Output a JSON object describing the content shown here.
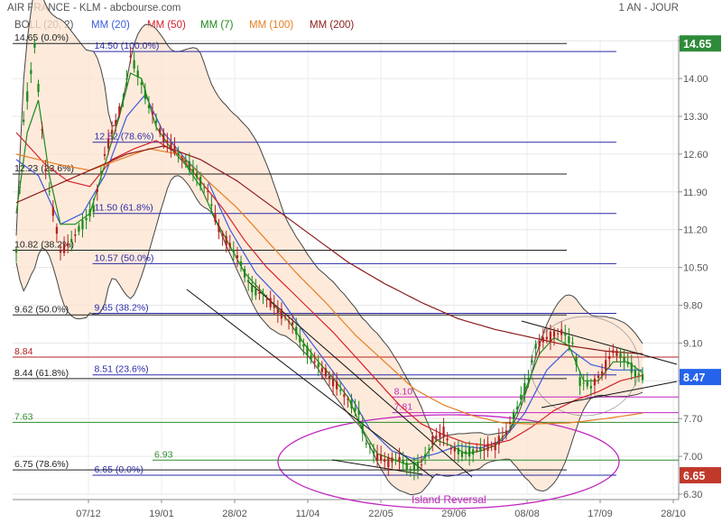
{
  "header": {
    "title": "AIR FRANCE - KLM - abcbourse.com",
    "period": "1 AN - JOUR",
    "legend": [
      {
        "label": "BOLL (20, 2)",
        "color": "#555555"
      },
      {
        "label": "MM (20)",
        "color": "#3b5bdb"
      },
      {
        "label": "MM (50)",
        "color": "#d6202a"
      },
      {
        "label": "MM (7)",
        "color": "#1a8a1a"
      },
      {
        "label": "MM (100)",
        "color": "#e67e22"
      },
      {
        "label": "MM (200)",
        "color": "#8b1a1a"
      }
    ]
  },
  "chart_data": {
    "type": "candlestick",
    "ylim": [
      6.3,
      14.72
    ],
    "y_ticks": [
      "14.70",
      "14.00",
      "13.30",
      "12.60",
      "11.90",
      "11.20",
      "10.50",
      "9.80",
      "9.10",
      "8.40",
      "7.70",
      "7.00",
      "6.30"
    ],
    "x_ticks": [
      "07/12",
      "19/01",
      "28/02",
      "11/04",
      "22/05",
      "29/06",
      "08/08",
      "17/09",
      "28/10"
    ],
    "price_badges": [
      {
        "label": "14.65",
        "value": 14.65,
        "color": "#2e8b3a"
      },
      {
        "label": "8.47",
        "value": 8.47,
        "color": "#2563eb"
      },
      {
        "label": "6.65",
        "value": 6.65,
        "color": "#c0392b"
      }
    ],
    "levels": [
      {
        "label": "14.65  (0.0%)",
        "value": 14.65,
        "color": "#222222",
        "x0": 0,
        "x1": 100
      },
      {
        "label": "14.50  (100.0%)",
        "value": 14.5,
        "color": "#2a2aa8",
        "x0": 12,
        "x1": 100
      },
      {
        "label": "12.82  (78.6%)",
        "value": 12.82,
        "color": "#2a2aa8",
        "x0": 12,
        "x1": 100
      },
      {
        "label": "12.23  (23.6%)",
        "value": 12.23,
        "color": "#222222",
        "x0": 0,
        "x1": 100
      },
      {
        "label": "11.50  (61.8%)",
        "value": 11.5,
        "color": "#2a2aa8",
        "x0": 12,
        "x1": 100
      },
      {
        "label": "10.82  (38.2%)",
        "value": 10.82,
        "color": "#222222",
        "x0": 0,
        "x1": 100
      },
      {
        "label": "10.57  (50.0%)",
        "value": 10.57,
        "color": "#2a2aa8",
        "x0": 12,
        "x1": 100
      },
      {
        "label": "9.62  (50.0%)",
        "value": 9.62,
        "color": "#222222",
        "x0": 0,
        "x1": 100
      },
      {
        "label": "9.65  (38.2%)",
        "value": 9.65,
        "color": "#2a2aa8",
        "x0": 12,
        "x1": 100
      },
      {
        "label": "8.84",
        "value": 8.84,
        "color": "#b22222",
        "x0": 0,
        "x1": 100
      },
      {
        "label": "8.44  (61.8%)",
        "value": 8.44,
        "color": "#222222",
        "x0": 0,
        "x1": 100
      },
      {
        "label": "8.51  (23.6%)",
        "value": 8.51,
        "color": "#2a2aa8",
        "x0": 12,
        "x1": 100
      },
      {
        "label": "8.10",
        "value": 8.1,
        "color": "#c026c0",
        "x0": 57,
        "x1": 100
      },
      {
        "label": "7.81",
        "value": 7.81,
        "color": "#c026c0",
        "x0": 57,
        "x1": 100
      },
      {
        "label": "7.63",
        "value": 7.63,
        "color": "#2e8b2e",
        "x0": 0,
        "x1": 100
      },
      {
        "label": "6.93",
        "value": 6.93,
        "color": "#2e8b2e",
        "x0": 21,
        "x1": 100
      },
      {
        "label": "6.75  (78.6%)",
        "value": 6.75,
        "color": "#222222",
        "x0": 0,
        "x1": 100
      },
      {
        "label": "6.65  (0.0%)",
        "value": 6.65,
        "color": "#2a2aa8",
        "x0": 12,
        "x1": 100
      }
    ],
    "annotations": [
      {
        "label": "Island Reversal",
        "color": "#c026c0"
      }
    ],
    "price_anchors": [
      [
        0,
        10.8
      ],
      [
        2,
        13.2
      ],
      [
        5,
        14.6
      ],
      [
        8,
        12.3
      ],
      [
        12,
        10.8
      ],
      [
        14,
        10.9
      ],
      [
        18,
        11.3
      ],
      [
        21,
        11.6
      ],
      [
        24,
        12.6
      ],
      [
        26,
        13.0
      ],
      [
        29,
        13.6
      ],
      [
        31,
        14.4
      ],
      [
        33,
        14.1
      ],
      [
        36,
        13.5
      ],
      [
        40,
        12.9
      ],
      [
        44,
        12.6
      ],
      [
        48,
        12.3
      ],
      [
        52,
        11.9
      ],
      [
        55,
        11.2
      ],
      [
        58,
        10.9
      ],
      [
        60,
        10.7
      ],
      [
        64,
        10.1
      ],
      [
        67,
        10.0
      ],
      [
        71,
        9.7
      ],
      [
        75,
        9.45
      ],
      [
        78,
        9.05
      ],
      [
        81,
        8.75
      ],
      [
        84,
        8.55
      ],
      [
        87,
        8.3
      ],
      [
        90,
        8.05
      ],
      [
        93,
        7.8
      ],
      [
        95,
        7.25
      ],
      [
        98,
        7.0
      ],
      [
        101,
        6.9
      ],
      [
        104,
        6.95
      ],
      [
        107,
        6.75
      ],
      [
        110,
        6.85
      ],
      [
        113,
        7.3
      ],
      [
        116,
        7.45
      ],
      [
        118,
        7.15
      ],
      [
        121,
        7.05
      ],
      [
        124,
        7.1
      ],
      [
        127,
        7.15
      ],
      [
        130,
        7.2
      ],
      [
        133,
        7.45
      ],
      [
        136,
        7.9
      ],
      [
        139,
        8.45
      ],
      [
        141,
        9.05
      ],
      [
        144,
        9.2
      ],
      [
        148,
        9.3
      ],
      [
        151,
        9.1
      ],
      [
        153,
        8.4
      ],
      [
        156,
        8.3
      ],
      [
        159,
        8.55
      ],
      [
        162,
        8.95
      ],
      [
        165,
        8.8
      ],
      [
        168,
        8.55
      ],
      [
        170,
        8.47
      ]
    ],
    "ma_anchors": {
      "MM (20)": [
        [
          0,
          12.5
        ],
        [
          6,
          12.2
        ],
        [
          12,
          11.3
        ],
        [
          18,
          11.5
        ],
        [
          24,
          12.2
        ],
        [
          30,
          13.3
        ],
        [
          35,
          13.7
        ],
        [
          40,
          13.0
        ],
        [
          46,
          12.5
        ],
        [
          52,
          12.1
        ],
        [
          58,
          11.2
        ],
        [
          65,
          10.4
        ],
        [
          72,
          9.9
        ],
        [
          78,
          9.3
        ],
        [
          84,
          8.75
        ],
        [
          90,
          8.2
        ],
        [
          96,
          7.5
        ],
        [
          102,
          7.1
        ],
        [
          108,
          6.95
        ],
        [
          114,
          7.05
        ],
        [
          120,
          7.2
        ],
        [
          126,
          7.15
        ],
        [
          132,
          7.3
        ],
        [
          138,
          7.8
        ],
        [
          144,
          8.6
        ],
        [
          150,
          9.0
        ],
        [
          156,
          8.7
        ],
        [
          162,
          8.6
        ],
        [
          170,
          8.6
        ]
      ],
      "MM (50)": [
        [
          0,
          13.0
        ],
        [
          8,
          12.4
        ],
        [
          14,
          12.1
        ],
        [
          20,
          12.0
        ],
        [
          26,
          12.5
        ],
        [
          32,
          12.7
        ],
        [
          38,
          12.85
        ],
        [
          44,
          12.6
        ],
        [
          50,
          12.1
        ],
        [
          56,
          11.6
        ],
        [
          62,
          11.0
        ],
        [
          68,
          10.5
        ],
        [
          74,
          10.1
        ],
        [
          80,
          9.7
        ],
        [
          86,
          9.3
        ],
        [
          92,
          8.85
        ],
        [
          98,
          8.4
        ],
        [
          104,
          7.95
        ],
        [
          110,
          7.6
        ],
        [
          116,
          7.4
        ],
        [
          122,
          7.25
        ],
        [
          128,
          7.2
        ],
        [
          134,
          7.3
        ],
        [
          140,
          7.55
        ],
        [
          146,
          7.85
        ],
        [
          152,
          8.05
        ],
        [
          158,
          8.2
        ],
        [
          164,
          8.4
        ],
        [
          170,
          8.5
        ]
      ],
      "MM (7)": [
        [
          0,
          11.5
        ],
        [
          3,
          13.0
        ],
        [
          6,
          13.6
        ],
        [
          9,
          12.2
        ],
        [
          12,
          11.3
        ],
        [
          16,
          11.3
        ],
        [
          20,
          11.5
        ],
        [
          24,
          12.4
        ],
        [
          28,
          13.3
        ],
        [
          31,
          14.1
        ],
        [
          34,
          14.0
        ],
        [
          38,
          13.1
        ],
        [
          42,
          12.7
        ],
        [
          46,
          12.4
        ],
        [
          50,
          12.0
        ],
        [
          54,
          11.4
        ],
        [
          58,
          10.9
        ],
        [
          62,
          10.4
        ],
        [
          66,
          10.1
        ],
        [
          70,
          9.8
        ],
        [
          74,
          9.5
        ],
        [
          78,
          9.1
        ],
        [
          82,
          8.75
        ],
        [
          86,
          8.45
        ],
        [
          90,
          8.1
        ],
        [
          94,
          7.5
        ],
        [
          98,
          7.05
        ],
        [
          102,
          6.95
        ],
        [
          106,
          6.85
        ],
        [
          110,
          6.9
        ],
        [
          114,
          7.3
        ],
        [
          118,
          7.2
        ],
        [
          122,
          7.05
        ],
        [
          126,
          7.1
        ],
        [
          130,
          7.2
        ],
        [
          134,
          7.5
        ],
        [
          138,
          8.2
        ],
        [
          142,
          8.9
        ],
        [
          146,
          9.2
        ],
        [
          150,
          9.05
        ],
        [
          154,
          8.4
        ],
        [
          158,
          8.4
        ],
        [
          162,
          8.75
        ],
        [
          166,
          8.75
        ],
        [
          170,
          8.55
        ]
      ],
      "MM (100)": [
        [
          0,
          12.6
        ],
        [
          12,
          12.4
        ],
        [
          20,
          12.3
        ],
        [
          28,
          12.5
        ],
        [
          36,
          12.7
        ],
        [
          44,
          12.6
        ],
        [
          52,
          12.1
        ],
        [
          60,
          11.6
        ],
        [
          68,
          11.0
        ],
        [
          76,
          10.4
        ],
        [
          84,
          9.85
        ],
        [
          92,
          9.25
        ],
        [
          100,
          8.75
        ],
        [
          108,
          8.25
        ],
        [
          116,
          7.95
        ],
        [
          124,
          7.75
        ],
        [
          132,
          7.62
        ],
        [
          140,
          7.6
        ],
        [
          150,
          7.62
        ],
        [
          160,
          7.7
        ],
        [
          170,
          7.8
        ]
      ],
      "MM (200)": [
        [
          0,
          11.7
        ],
        [
          10,
          12.0
        ],
        [
          20,
          12.3
        ],
        [
          30,
          12.6
        ],
        [
          40,
          12.75
        ],
        [
          50,
          12.5
        ],
        [
          60,
          12.1
        ],
        [
          70,
          11.6
        ],
        [
          80,
          11.1
        ],
        [
          90,
          10.6
        ],
        [
          100,
          10.2
        ],
        [
          110,
          9.85
        ],
        [
          120,
          9.55
        ],
        [
          130,
          9.35
        ],
        [
          140,
          9.2
        ],
        [
          150,
          9.05
        ],
        [
          160,
          8.95
        ],
        [
          170,
          8.9
        ]
      ]
    }
  }
}
